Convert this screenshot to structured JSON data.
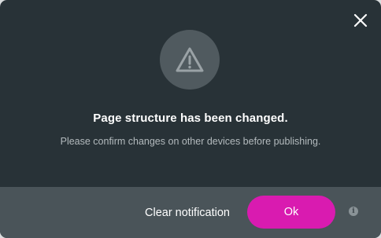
{
  "dialog": {
    "title": "Page structure has been changed.",
    "message": "Please confirm changes on other devices before publishing.",
    "close_icon": "close-icon",
    "warning_icon": "warning-icon"
  },
  "footer": {
    "clear_label": "Clear notification",
    "ok_label": "Ok",
    "info_icon": "info-icon",
    "info_glyph": "i"
  },
  "colors": {
    "dialog_bg": "#283237",
    "footer_bg": "#4a5459",
    "accent": "#d91bb0",
    "icon_circle": "#505a5f"
  }
}
